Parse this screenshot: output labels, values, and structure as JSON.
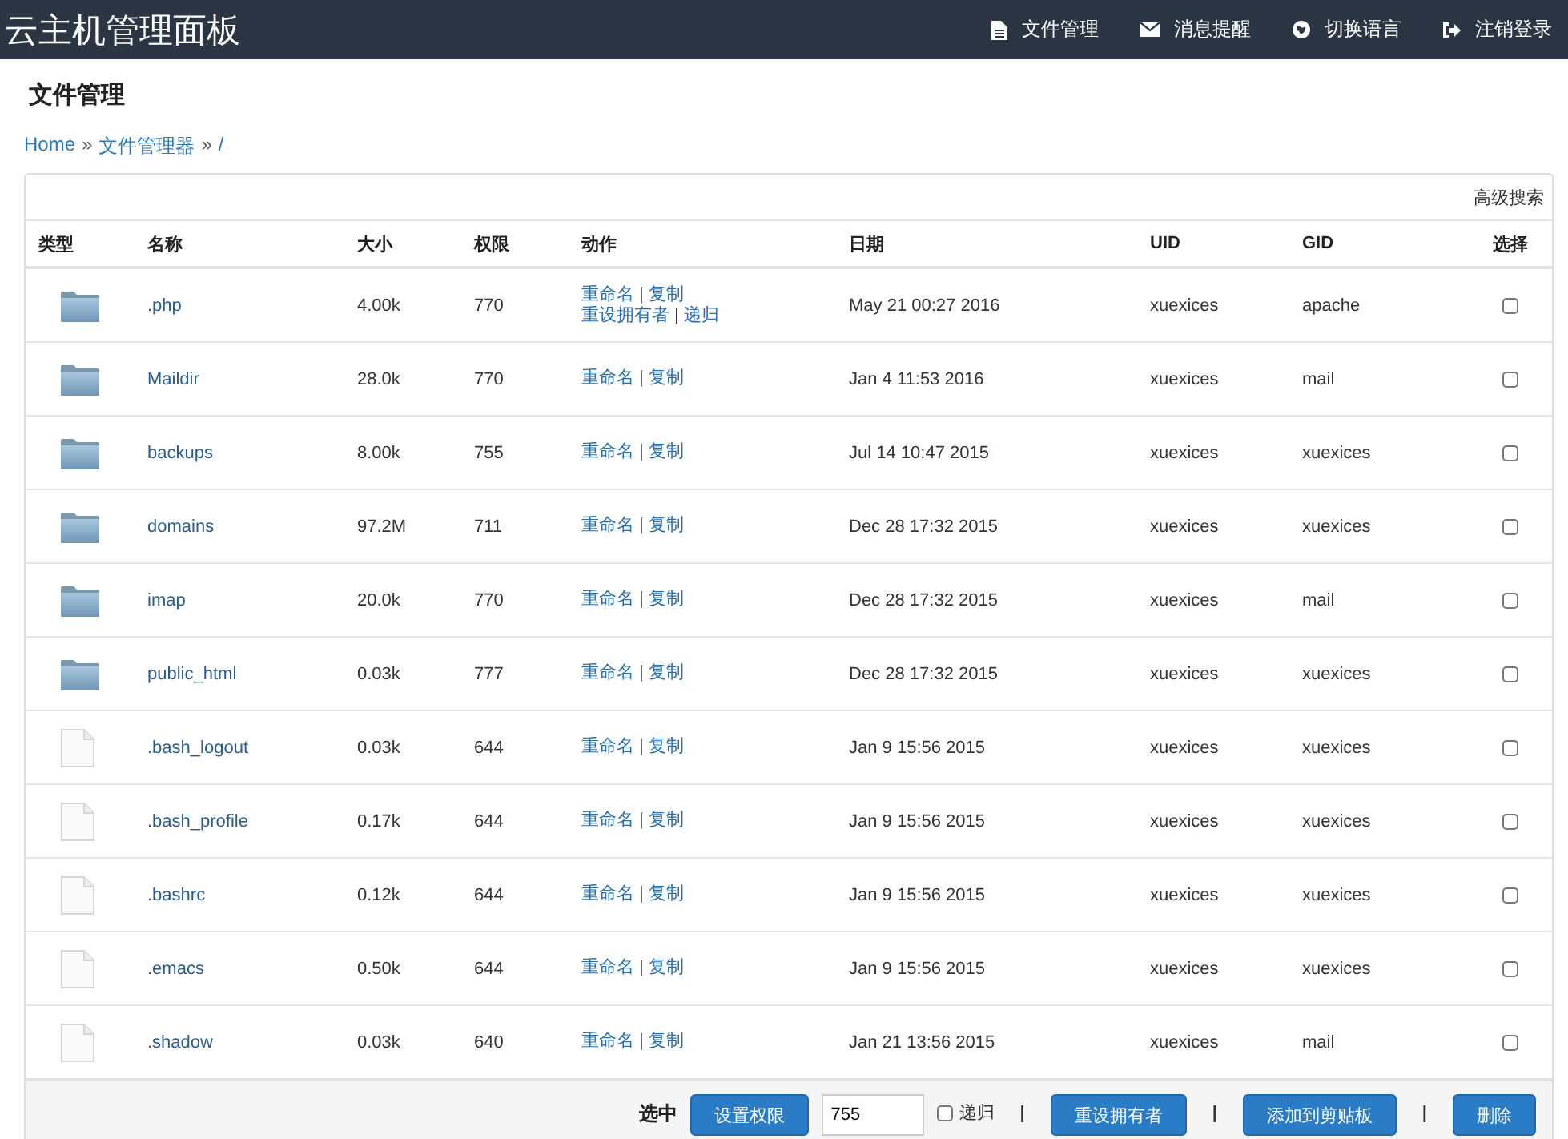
{
  "navbar": {
    "title": "云主机管理面板",
    "items": [
      {
        "kind": "file",
        "label": "文件管理"
      },
      {
        "kind": "mail",
        "label": "消息提醒"
      },
      {
        "kind": "globe",
        "label": "切换语言"
      },
      {
        "kind": "logout",
        "label": "注销登录"
      }
    ]
  },
  "page_title": "文件管理",
  "breadcrumb": {
    "items": [
      "Home",
      "文件管理器",
      "/"
    ],
    "separator": "»"
  },
  "panel": {
    "header_link": "高级搜索",
    "columns": [
      "类型",
      "名称",
      "大小",
      "权限",
      "动作",
      "日期",
      "UID",
      "GID",
      "选择"
    ],
    "action_separator": "|",
    "rows": [
      {
        "kind": "folder",
        "name": ".php",
        "size": "4.00k",
        "perm": "770",
        "actions": [
          [
            "重命名",
            "复制"
          ],
          [
            "重设拥有者",
            "递归"
          ]
        ],
        "date": "May 21 00:27 2016",
        "uid": "xuexices",
        "gid": "apache",
        "selected": false
      },
      {
        "kind": "folder",
        "name": "Maildir",
        "size": "28.0k",
        "perm": "770",
        "actions": [
          [
            "重命名",
            "复制"
          ]
        ],
        "date": "Jan 4 11:53 2016",
        "uid": "xuexices",
        "gid": "mail",
        "selected": false
      },
      {
        "kind": "folder",
        "name": "backups",
        "size": "8.00k",
        "perm": "755",
        "actions": [
          [
            "重命名",
            "复制"
          ]
        ],
        "date": "Jul 14 10:47 2015",
        "uid": "xuexices",
        "gid": "xuexices",
        "selected": false
      },
      {
        "kind": "folder",
        "name": "domains",
        "size": "97.2M",
        "perm": "711",
        "actions": [
          [
            "重命名",
            "复制"
          ]
        ],
        "date": "Dec 28 17:32 2015",
        "uid": "xuexices",
        "gid": "xuexices",
        "selected": false
      },
      {
        "kind": "folder",
        "name": "imap",
        "size": "20.0k",
        "perm": "770",
        "actions": [
          [
            "重命名",
            "复制"
          ]
        ],
        "date": "Dec 28 17:32 2015",
        "uid": "xuexices",
        "gid": "mail",
        "selected": false
      },
      {
        "kind": "folder",
        "name": "public_html",
        "size": "0.03k",
        "perm": "777",
        "actions": [
          [
            "重命名",
            "复制"
          ]
        ],
        "date": "Dec 28 17:32 2015",
        "uid": "xuexices",
        "gid": "xuexices",
        "selected": false
      },
      {
        "kind": "file",
        "name": ".bash_logout",
        "size": "0.03k",
        "perm": "644",
        "actions": [
          [
            "重命名",
            "复制"
          ]
        ],
        "date": "Jan 9 15:56 2015",
        "uid": "xuexices",
        "gid": "xuexices",
        "selected": false
      },
      {
        "kind": "file",
        "name": ".bash_profile",
        "size": "0.17k",
        "perm": "644",
        "actions": [
          [
            "重命名",
            "复制"
          ]
        ],
        "date": "Jan 9 15:56 2015",
        "uid": "xuexices",
        "gid": "xuexices",
        "selected": false
      },
      {
        "kind": "file",
        "name": ".bashrc",
        "size": "0.12k",
        "perm": "644",
        "actions": [
          [
            "重命名",
            "复制"
          ]
        ],
        "date": "Jan 9 15:56 2015",
        "uid": "xuexices",
        "gid": "xuexices",
        "selected": false
      },
      {
        "kind": "file",
        "name": ".emacs",
        "size": "0.50k",
        "perm": "644",
        "actions": [
          [
            "重命名",
            "复制"
          ]
        ],
        "date": "Jan 9 15:56 2015",
        "uid": "xuexices",
        "gid": "xuexices",
        "selected": false
      },
      {
        "kind": "file",
        "name": ".shadow",
        "size": "0.03k",
        "perm": "640",
        "actions": [
          [
            "重命名",
            "复制"
          ]
        ],
        "date": "Jan 21 13:56 2015",
        "uid": "xuexices",
        "gid": "mail",
        "selected": false
      }
    ],
    "footer": [
      {
        "kind": "label",
        "text": "选中"
      },
      {
        "kind": "button",
        "text": "设置权限"
      },
      {
        "kind": "input",
        "value": "755"
      },
      {
        "kind": "checkbox",
        "text": "递归",
        "checked": false
      },
      {
        "kind": "separator",
        "text": "|"
      },
      {
        "kind": "button",
        "text": "重设拥有者"
      },
      {
        "kind": "separator",
        "text": "|"
      },
      {
        "kind": "button",
        "text": "添加到剪贴板"
      },
      {
        "kind": "separator",
        "text": "|"
      },
      {
        "kind": "button",
        "text": "删除"
      }
    ]
  }
}
